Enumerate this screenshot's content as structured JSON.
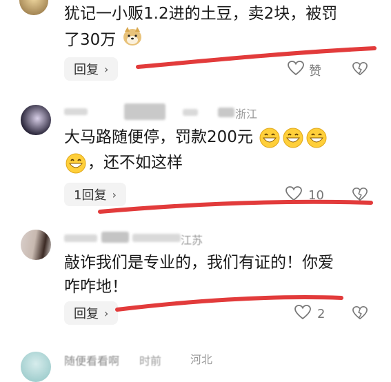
{
  "comments": [
    {
      "text_lines": [
        "犹记一小贩1.2进的土豆，卖2块，被罚",
        "了30万"
      ],
      "reply_label": "回复",
      "like_label": "赞"
    },
    {
      "location": "浙江",
      "text_line1": "大马路随便停，罚款200元",
      "text_line2": "，还不如这样",
      "reply_label": "1回复",
      "like_count": "10"
    },
    {
      "location": "江苏",
      "text_lines": [
        "敲诈我们是专业的，我们有证的！你爱",
        "咋咋地！"
      ],
      "reply_label": "回复",
      "like_count": "2"
    },
    {
      "user_partial": "随便看看啊",
      "time_partial": "时前",
      "location": "河北"
    }
  ],
  "icons": {
    "like": "heart-outline-icon",
    "dislike": "broken-heart-icon",
    "chevron": "chevron-right-icon"
  },
  "colors": {
    "accent_red": "#e23b3b",
    "meta_gray": "#9a9a9a",
    "button_bg": "#f3f3f3"
  }
}
